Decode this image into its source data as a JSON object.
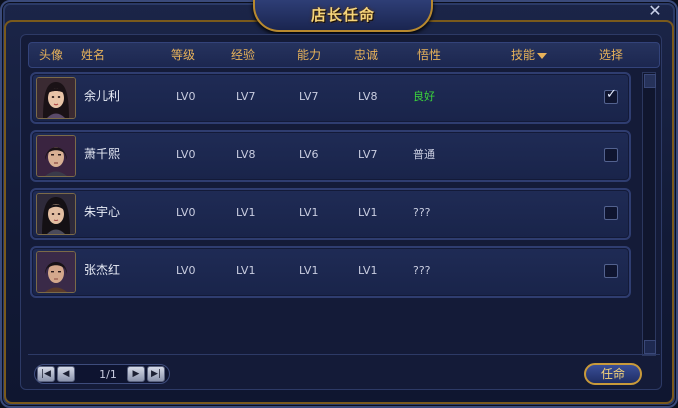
{
  "window": {
    "title": "店长任命",
    "close_label": "✕"
  },
  "header": {
    "avatar": "头像",
    "name": "姓名",
    "level": "等级",
    "exp": "经验",
    "ability": "能力",
    "loyalty": "忠诚",
    "aptitude": "悟性",
    "skill": "技能",
    "select": "选择"
  },
  "rows": [
    {
      "name": "余儿利",
      "level": "LV0",
      "exp": "LV7",
      "ability": "LV7",
      "loyalty": "LV8",
      "aptitude": "良好",
      "selected": true
    },
    {
      "name": "萧千熙",
      "level": "LV0",
      "exp": "LV8",
      "ability": "LV6",
      "loyalty": "LV7",
      "aptitude": "普通",
      "selected": false
    },
    {
      "name": "朱宇心",
      "level": "LV0",
      "exp": "LV1",
      "ability": "LV1",
      "loyalty": "LV1",
      "aptitude": "???",
      "selected": false
    },
    {
      "name": "张杰红",
      "level": "LV0",
      "exp": "LV1",
      "ability": "LV1",
      "loyalty": "LV1",
      "aptitude": "???",
      "selected": false
    }
  ],
  "pager": {
    "page_text": "1/1",
    "first_label": "|◀",
    "prev_label": "◀",
    "next_label": "▶",
    "last_label": "▶|"
  },
  "actions": {
    "appoint_label": "任命"
  },
  "colors": {
    "header_text": "#e7b25a",
    "good_aptitude": "#3bd43b",
    "title_text": "#f4d37a",
    "gold_trim": "#b8892e"
  }
}
